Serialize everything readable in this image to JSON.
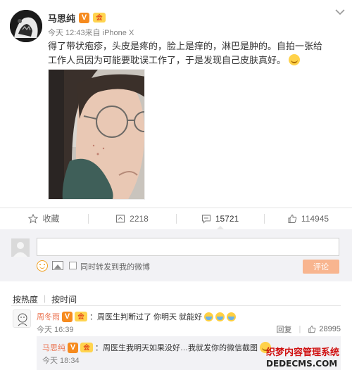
{
  "post": {
    "author": "马思纯",
    "verified_badge": "V",
    "vip_badge": "会",
    "time": "今天 12:43",
    "source": " 来自 iPhone X",
    "text": "得了带状疱疹，头皮是疼的，脸上是痒的，淋巴是肿的。自拍一张给工作人员因为可能要耽误工作了，于是发现自己皮肤真好。",
    "menu_icon": "chevron-down-icon"
  },
  "actions": {
    "favorite_label": "收藏",
    "repost_count": "2218",
    "comment_count": "15721",
    "like_count": "114945"
  },
  "composer": {
    "also_repost_label": "同时转发到我的微博",
    "submit_label": "评论",
    "input_value": ""
  },
  "sort": {
    "by_hot": "按热度",
    "by_time": "按时间"
  },
  "comment": {
    "user": "周冬雨",
    "text": "：周医生判断过了 你明天 就能好",
    "time": "今天 16:39",
    "reply_label": "回复",
    "likes": "28995"
  },
  "reply": {
    "user": "马思纯",
    "text": "：周医生我明天如果没好…我就发你的微信截图",
    "time": "今天 18:34"
  },
  "watermark": {
    "title": "织梦内容管理系统",
    "subtitle": "DEDECMS.COM"
  }
}
